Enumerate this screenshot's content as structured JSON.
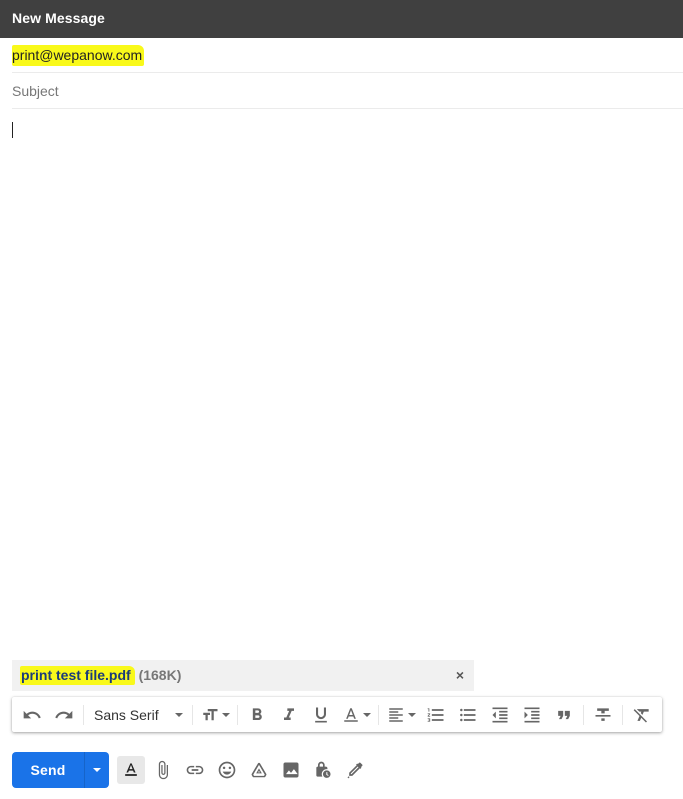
{
  "header": {
    "title": "New Message"
  },
  "recipients": {
    "to_value": "print@wepanow.com"
  },
  "subject": {
    "placeholder": "Subject",
    "value": ""
  },
  "body": {
    "text": ""
  },
  "attachment": {
    "name": "print test file.pdf",
    "size": "(168K)",
    "remove_label": "×"
  },
  "formatting": {
    "font": "Sans Serif",
    "buttons": [
      {
        "name": "undo",
        "label": "Undo"
      },
      {
        "name": "redo",
        "label": "Redo"
      },
      {
        "name": "size",
        "label": "Size"
      },
      {
        "name": "bold",
        "label": "Bold"
      },
      {
        "name": "italic",
        "label": "Italic"
      },
      {
        "name": "underline",
        "label": "Underline"
      },
      {
        "name": "text-color",
        "label": "Text color"
      },
      {
        "name": "align",
        "label": "Align"
      },
      {
        "name": "numbered-list",
        "label": "Numbered list"
      },
      {
        "name": "bulleted-list",
        "label": "Bulleted list"
      },
      {
        "name": "indent-less",
        "label": "Indent less"
      },
      {
        "name": "indent-more",
        "label": "Indent more"
      },
      {
        "name": "quote",
        "label": "Quote"
      },
      {
        "name": "strikethrough",
        "label": "Strikethrough"
      },
      {
        "name": "remove-formatting",
        "label": "Remove formatting"
      }
    ]
  },
  "actions": {
    "send_label": "Send",
    "send_more_label": "More send options",
    "tools": [
      {
        "name": "formatting-options",
        "label": "Formatting options",
        "active": true
      },
      {
        "name": "attach-files",
        "label": "Attach files"
      },
      {
        "name": "insert-link",
        "label": "Insert link"
      },
      {
        "name": "insert-emoji",
        "label": "Insert emoji"
      },
      {
        "name": "insert-drive",
        "label": "Insert files using Drive"
      },
      {
        "name": "insert-photo",
        "label": "Insert photo"
      },
      {
        "name": "confidential-mode",
        "label": "Toggle confidential mode"
      },
      {
        "name": "insert-signature",
        "label": "Insert signature"
      }
    ]
  },
  "colors": {
    "header_bg": "#404040",
    "send_blue": "#1a73e8",
    "highlight": "#f9f91a",
    "attachment_bg": "#f1f1f1"
  }
}
